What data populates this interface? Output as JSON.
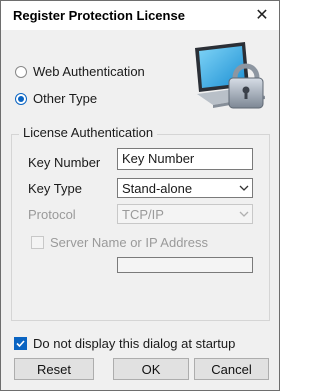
{
  "window": {
    "title": "Register Protection License",
    "close_glyph": "✕"
  },
  "auth_options": {
    "web_label": "Web Authentication",
    "other_label": "Other Type",
    "selected": "other"
  },
  "license_group": {
    "legend": "License Authentication",
    "key_number_label": "Key Number",
    "key_number_value": "Key Number",
    "key_type_label": "Key Type",
    "key_type_value": "Stand-alone",
    "protocol_label": "Protocol",
    "protocol_value": "TCP/IP",
    "server_label": "Server Name or IP Address",
    "server_value": ""
  },
  "startup_checkbox": {
    "label": "Do not display this dialog at startup",
    "checked": true
  },
  "buttons": {
    "reset": "Reset",
    "ok": "OK",
    "cancel": "Cancel"
  },
  "colors": {
    "accent": "#0a64c2",
    "disabled_text": "#9a9a9a",
    "dialog_bg": "#f0f0f0"
  },
  "icons": {
    "graphic": "laptop-padlock-icon",
    "close": "close-icon",
    "dropdown": "chevron-down-icon",
    "checkmark": "checkmark-icon"
  }
}
